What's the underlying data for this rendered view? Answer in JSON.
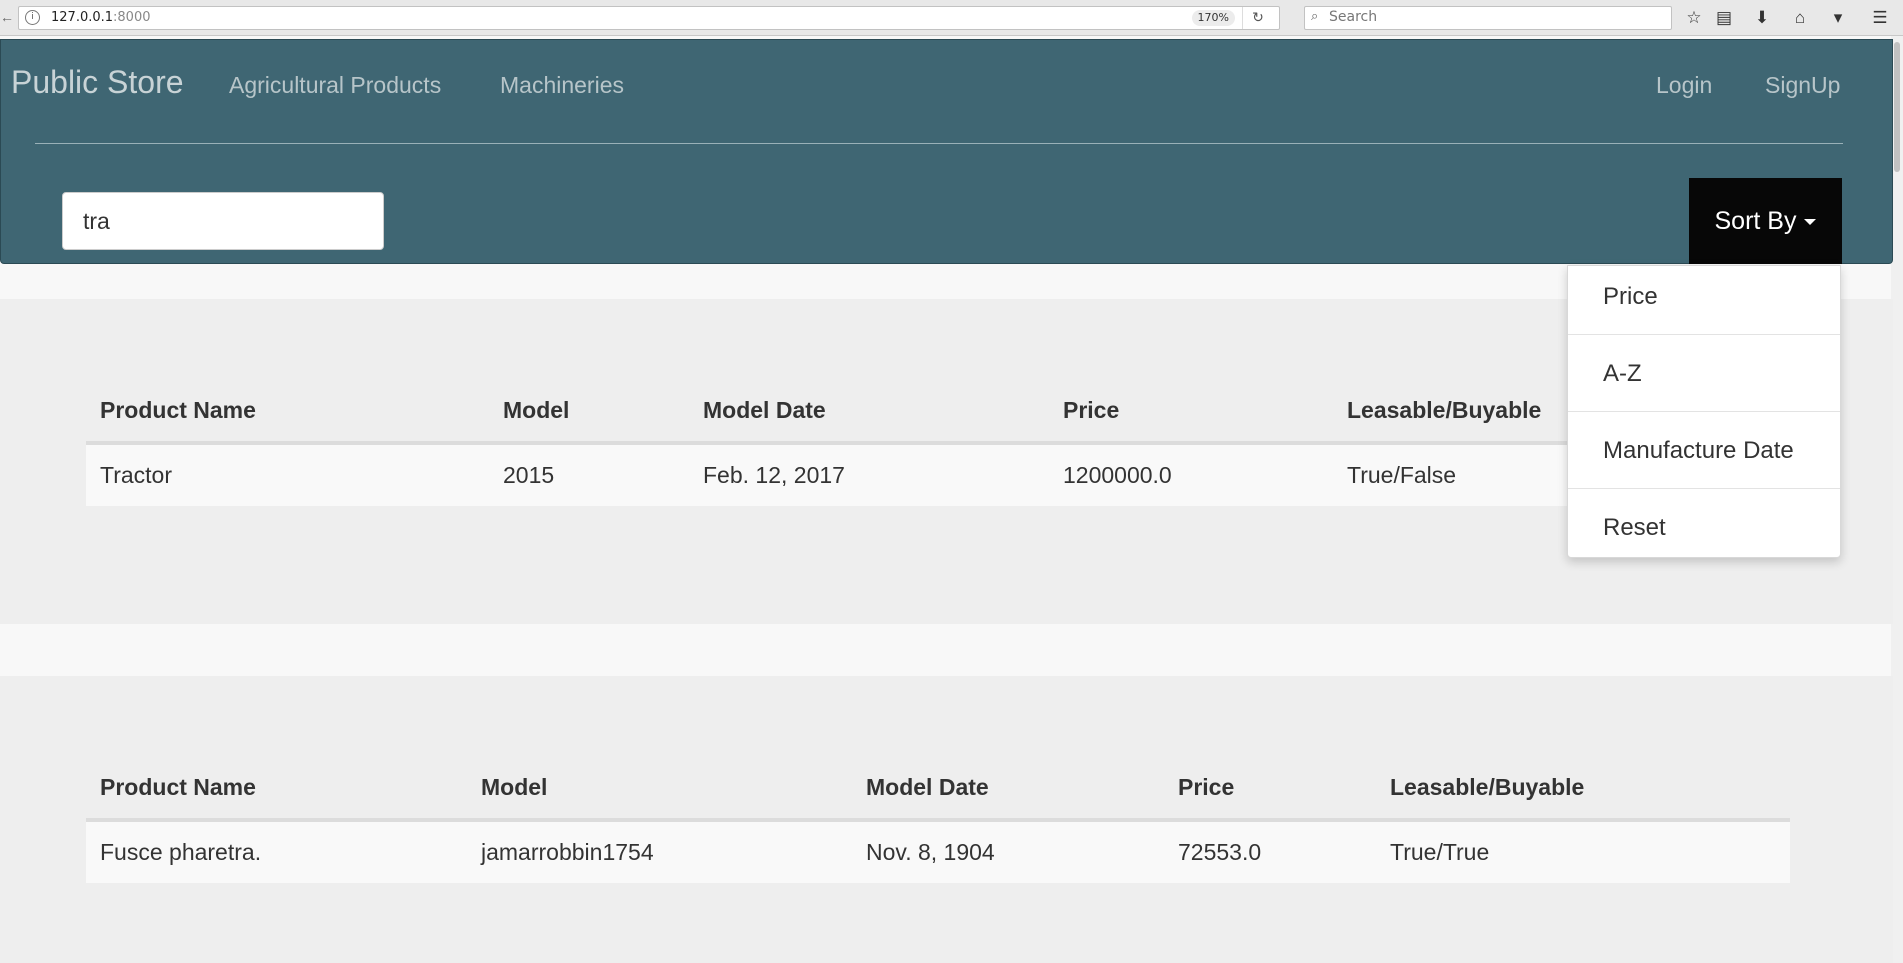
{
  "browser": {
    "url_host": "127.0.0.1",
    "url_port": ":8000",
    "zoom": "170%",
    "search_placeholder": "Search"
  },
  "navbar": {
    "brand": "Public Store",
    "links": [
      "Agricultural Products",
      "Machineries"
    ],
    "auth": [
      "Login",
      "SignUp"
    ],
    "search_value": "tra",
    "sort_label": "Sort By"
  },
  "sort_menu": [
    "Price",
    "A-Z",
    "Manufacture Date",
    "Reset"
  ],
  "tables": [
    {
      "headers": [
        "Product Name",
        "Model",
        "Model Date",
        "Price",
        "Leasable/Buyable"
      ],
      "rows": [
        [
          "Tractor",
          "2015",
          "Feb. 12, 2017",
          "1200000.0",
          "True/False"
        ]
      ]
    },
    {
      "headers": [
        "Product Name",
        "Model",
        "Model Date",
        "Price",
        "Leasable/Buyable"
      ],
      "rows": [
        [
          "Fusce pharetra.",
          "jamarrobbin1754",
          "Nov. 8, 1904",
          "72553.0",
          "True/True"
        ]
      ]
    }
  ]
}
